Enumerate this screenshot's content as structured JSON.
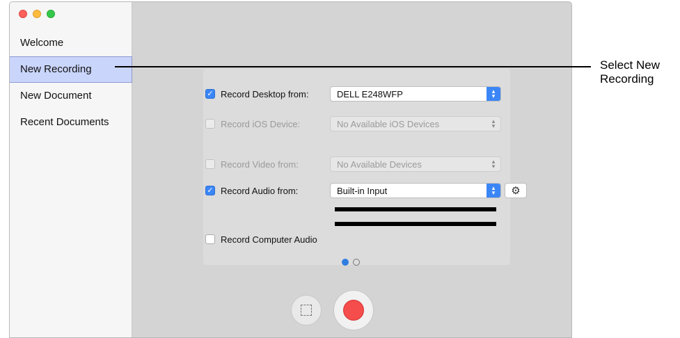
{
  "sidebar": {
    "items": [
      {
        "label": "Welcome"
      },
      {
        "label": "New Recording"
      },
      {
        "label": "New Document"
      },
      {
        "label": "Recent Documents"
      }
    ]
  },
  "recording": {
    "desktop": {
      "label": "Record Desktop from:",
      "checked": true,
      "value": "DELL E248WFP"
    },
    "ios": {
      "label": "Record iOS Device:",
      "checked": false,
      "value": "No Available iOS Devices"
    },
    "video": {
      "label": "Record Video from:",
      "checked": false,
      "value": "No Available Devices"
    },
    "audio": {
      "label": "Record Audio from:",
      "checked": true,
      "value": "Built-in Input"
    },
    "computer_audio": {
      "label": "Record Computer Audio",
      "checked": false
    }
  },
  "pagination": {
    "current": 1,
    "total": 2
  },
  "callout": {
    "line1": "Select New",
    "line2": "Recording"
  },
  "icons": {
    "checkbox_check": "✓",
    "gear": "⚙",
    "stepper_up": "▴",
    "stepper_down": "▾"
  },
  "colors": {
    "accent": "#3b86f7",
    "selected_item": "#c9d5fb",
    "record": "#f54c4c"
  }
}
